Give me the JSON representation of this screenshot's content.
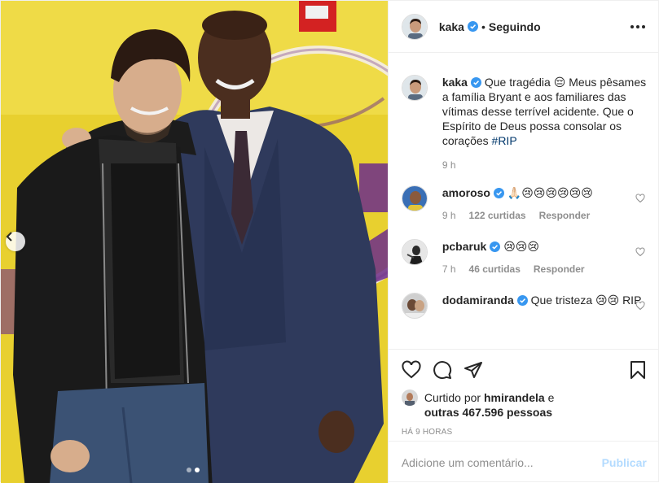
{
  "post": {
    "author": "kaka",
    "following_label": "Seguindo",
    "bullet": "•",
    "dots": [
      false,
      true
    ]
  },
  "caption": {
    "username": "kaka",
    "text": "Que tragédia 😔 Meus pêsames a família Bryant e aos familiares das vítimas desse terrível acidente. Que o Espírito de Deus possa consolar os corações",
    "hashtag": "#RIP",
    "time": "9 h"
  },
  "comments": [
    {
      "username": "amoroso",
      "text": "🙏🏻😢😢😢😢😢😢",
      "time": "9 h",
      "likes": "122 curtidas",
      "reply": "Responder"
    },
    {
      "username": "pcbaruk",
      "text": "😢😢😢",
      "time": "7 h",
      "likes": "46 curtidas",
      "reply": "Responder"
    },
    {
      "username": "dodamiranda",
      "text": "Que tristeza 😢😢 RIP",
      "time": "",
      "likes": "",
      "reply": ""
    }
  ],
  "likes": {
    "prefix": "Curtido por",
    "user": "hmirandela",
    "mid": "e",
    "others": "outras 467.596 pessoas"
  },
  "posted_ago": "HÁ 9 HORAS",
  "comment_box": {
    "placeholder": "Adicione um comentário...",
    "publish_label": "Publicar"
  },
  "colors": {
    "accent": "#0095f6",
    "verified": "#3897f0",
    "publish_disabled": "#b3dbff",
    "muted": "#8e8e8e",
    "background_wall": "#e9d23b",
    "lakers_purple": "#6c2d8a"
  }
}
